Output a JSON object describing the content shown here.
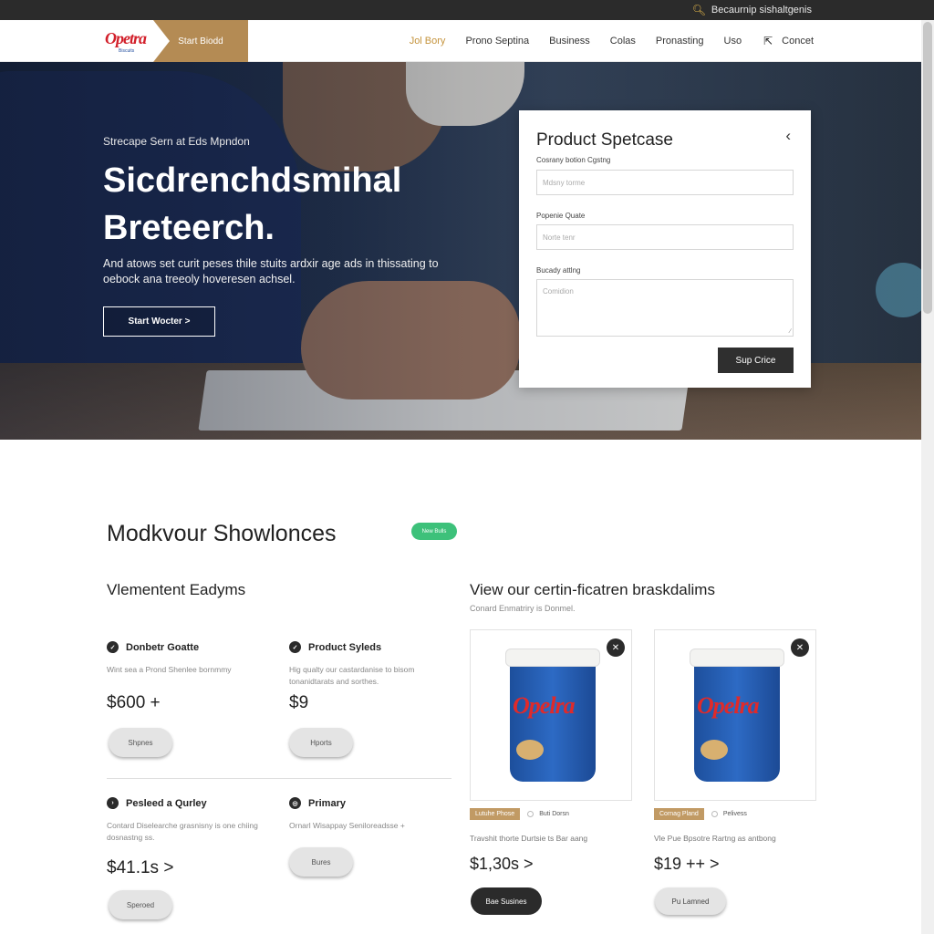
{
  "topbar": {
    "icon": "search-icon",
    "text": "Becaurnip sishaltgenis"
  },
  "nav": {
    "logo_text": "Opetra",
    "logo_sub": "Biscuits",
    "cta": "Start Biodd",
    "links": [
      "Jol Bory",
      "Prono Septina",
      "Business",
      "Colas",
      "Pronasting",
      "Uso"
    ],
    "active_index": 0,
    "ext_icon": "external-link-icon",
    "contact": "Concet"
  },
  "hero": {
    "kicker": "Strecape Sern at Eds Mpndon",
    "title": "Sicdrenchdsmihal Breteerch.",
    "description": "And atows set curit peses thile stuits ardxir age ads in thissating to oebock ana treeoly hoveresen achsel.",
    "button": "Start Wocter >"
  },
  "form": {
    "title": "Product Spetcase",
    "close_icon": "close-chevron-icon",
    "field1_label": "Cosrany botion Cgstng",
    "field1_placeholder": "Mdsny torme",
    "field2_label": "Popenie Quate",
    "field2_placeholder": "Norte tenr",
    "field3_label": "Bucady attlng",
    "field3_placeholder": "Comidion",
    "submit": "Sup Crice"
  },
  "section": {
    "title": "Modkvour Showlonces",
    "badge": "New Bulls"
  },
  "left_column": {
    "heading": "Vlementent Eadyms",
    "items": [
      {
        "title": "Donbetr Goatte",
        "desc": "Wint sea a Prond Shenlee bornmmy",
        "price": "$600 +",
        "button": "Shpnes"
      },
      {
        "title": "Product Syleds",
        "desc": "Hig qualty our castardanise to bisom tonanidtarats and sorthes.",
        "price": "$9",
        "button": "Hports"
      },
      {
        "title": "Pesleed a Qurley",
        "desc": "Contard Diselearche grasnisny is one chiing dosnastng ss.",
        "price": "$41.1s >",
        "button": "Speroed"
      },
      {
        "title": "Primary",
        "desc": "Ornarl Wisappay Seniloreadsse +",
        "price": "",
        "button": "Bures"
      }
    ]
  },
  "right_column": {
    "heading": "View our certin-ficatren braskdalims",
    "subheading": "Conard Enmatriry is Donmel.",
    "products": [
      {
        "brand": "Opelra",
        "tag": "Lutuhe Phose",
        "variant": "Buti Dorsn",
        "desc": "Travshit thorte Durtsie ts Bar aang",
        "price": "$1,30s >",
        "button": "Bae Susines",
        "dark": true
      },
      {
        "brand": "Opelra",
        "tag": "Cornag Pland",
        "variant": "Pelivess",
        "desc": "Vle Pue Bpsotre Rartng as antbong",
        "price": "$19 ++ >",
        "button": "Pu Lamned",
        "dark": false
      }
    ]
  },
  "colors": {
    "accent": "#b48b54",
    "badge": "#3dc17a",
    "dark": "#2b2b2b"
  }
}
